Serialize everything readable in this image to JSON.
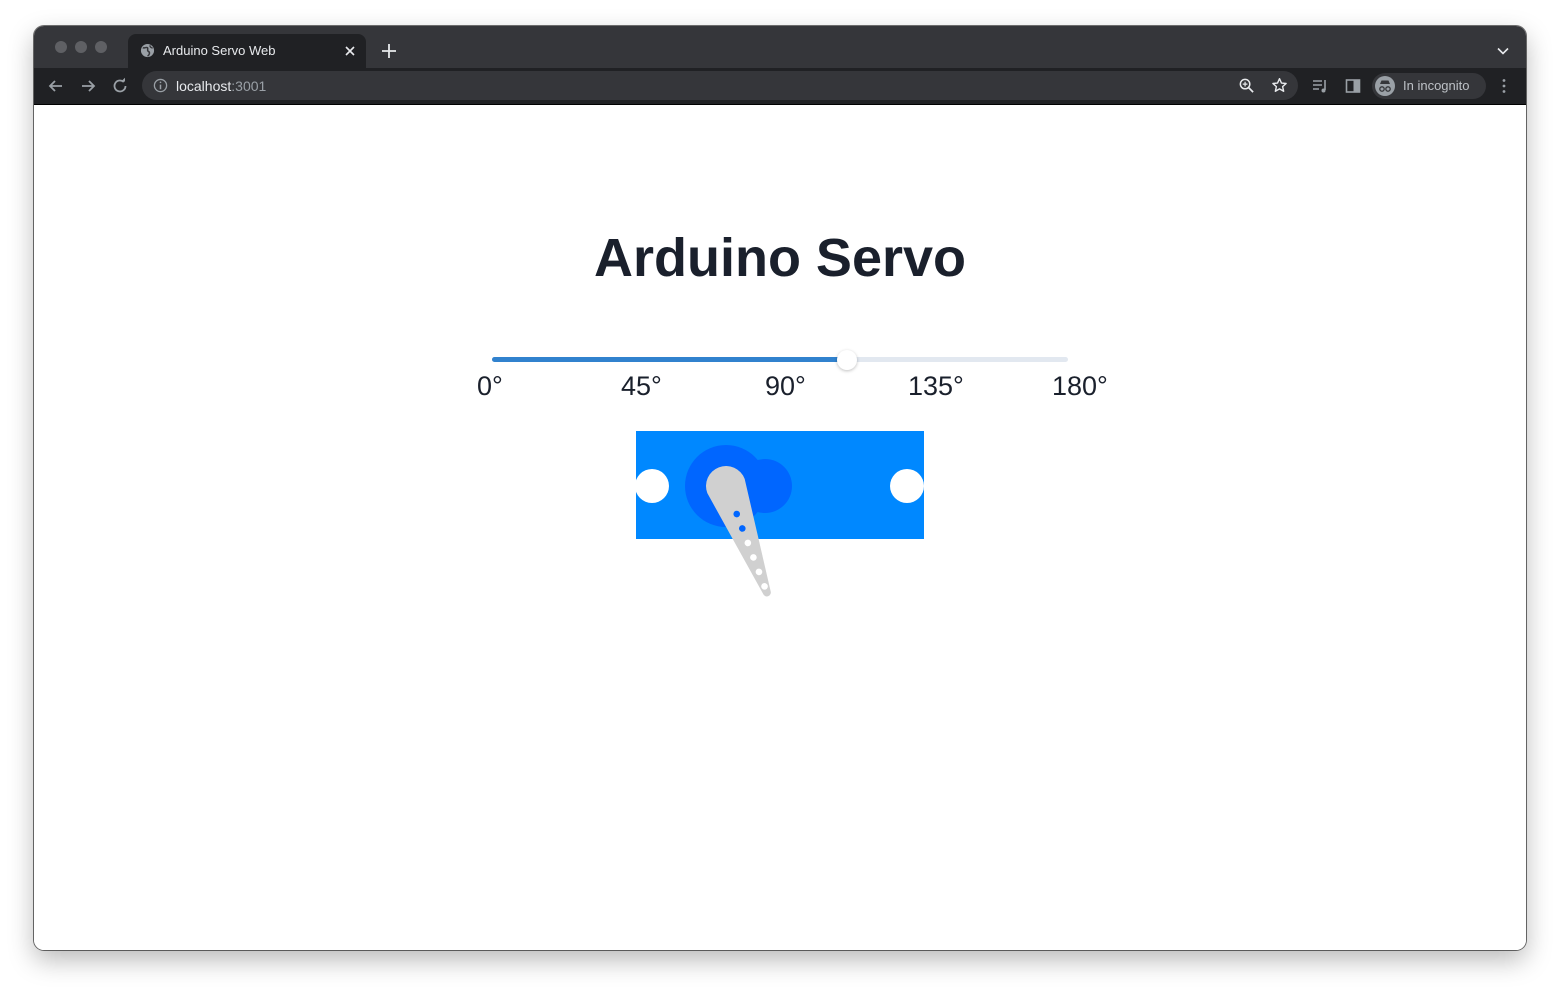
{
  "browser": {
    "tab_title": "Arduino Servo Web",
    "url_host": "localhost",
    "url_port": ":3001",
    "incognito_label": "In incognito"
  },
  "page": {
    "title": "Arduino Servo"
  },
  "slider": {
    "min": 0,
    "max": 180,
    "value": 111,
    "ticks": [
      "0°",
      "45°",
      "90°",
      "135°",
      "180°"
    ]
  },
  "colors": {
    "accent": "#3182ce",
    "servo_body": "#0088ff",
    "servo_gear": "#0066ff",
    "servo_horn": "#d0d0d0"
  }
}
